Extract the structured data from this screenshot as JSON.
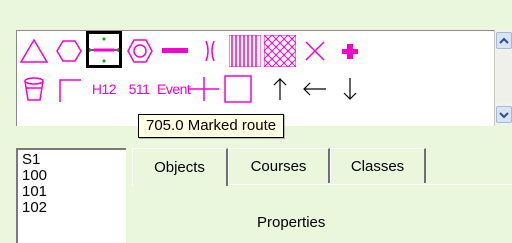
{
  "palette": {
    "row1": [
      {
        "name": "triangle-symbol-icon"
      },
      {
        "name": "circle-symbol-icon"
      },
      {
        "name": "marked-route-symbol-icon",
        "selected": true
      },
      {
        "name": "double-circle-symbol-icon"
      },
      {
        "name": "thick-line-symbol-icon"
      },
      {
        "name": "narrow-passage-symbol-icon"
      },
      {
        "name": "vertical-hatch-area-icon"
      },
      {
        "name": "cross-hatch-area-icon"
      },
      {
        "name": "x-cross-symbol-icon"
      },
      {
        "name": "first-aid-cross-icon"
      }
    ],
    "row2": [
      {
        "name": "water-cup-symbol-icon"
      },
      {
        "name": "corner-line-symbol-icon"
      },
      {
        "name": "text-h12",
        "text": "H12"
      },
      {
        "name": "text-511",
        "text": "511"
      },
      {
        "name": "text-event",
        "text": "Event"
      },
      {
        "name": "plus-line-symbol-icon"
      },
      {
        "name": "square-symbol-icon"
      },
      {
        "name": "arrow-up-icon"
      },
      {
        "name": "arrow-left-icon"
      },
      {
        "name": "arrow-down-icon"
      }
    ],
    "symbol_color": "#ff00cc"
  },
  "tooltip": {
    "text": "705.0 Marked route"
  },
  "list": {
    "items": [
      "S1",
      "100",
      "101",
      "102"
    ]
  },
  "tabs": [
    {
      "label": "Objects",
      "active": true
    },
    {
      "label": "Courses",
      "active": false
    },
    {
      "label": "Classes",
      "active": false
    }
  ],
  "panel": {
    "properties_label": "Properties"
  }
}
